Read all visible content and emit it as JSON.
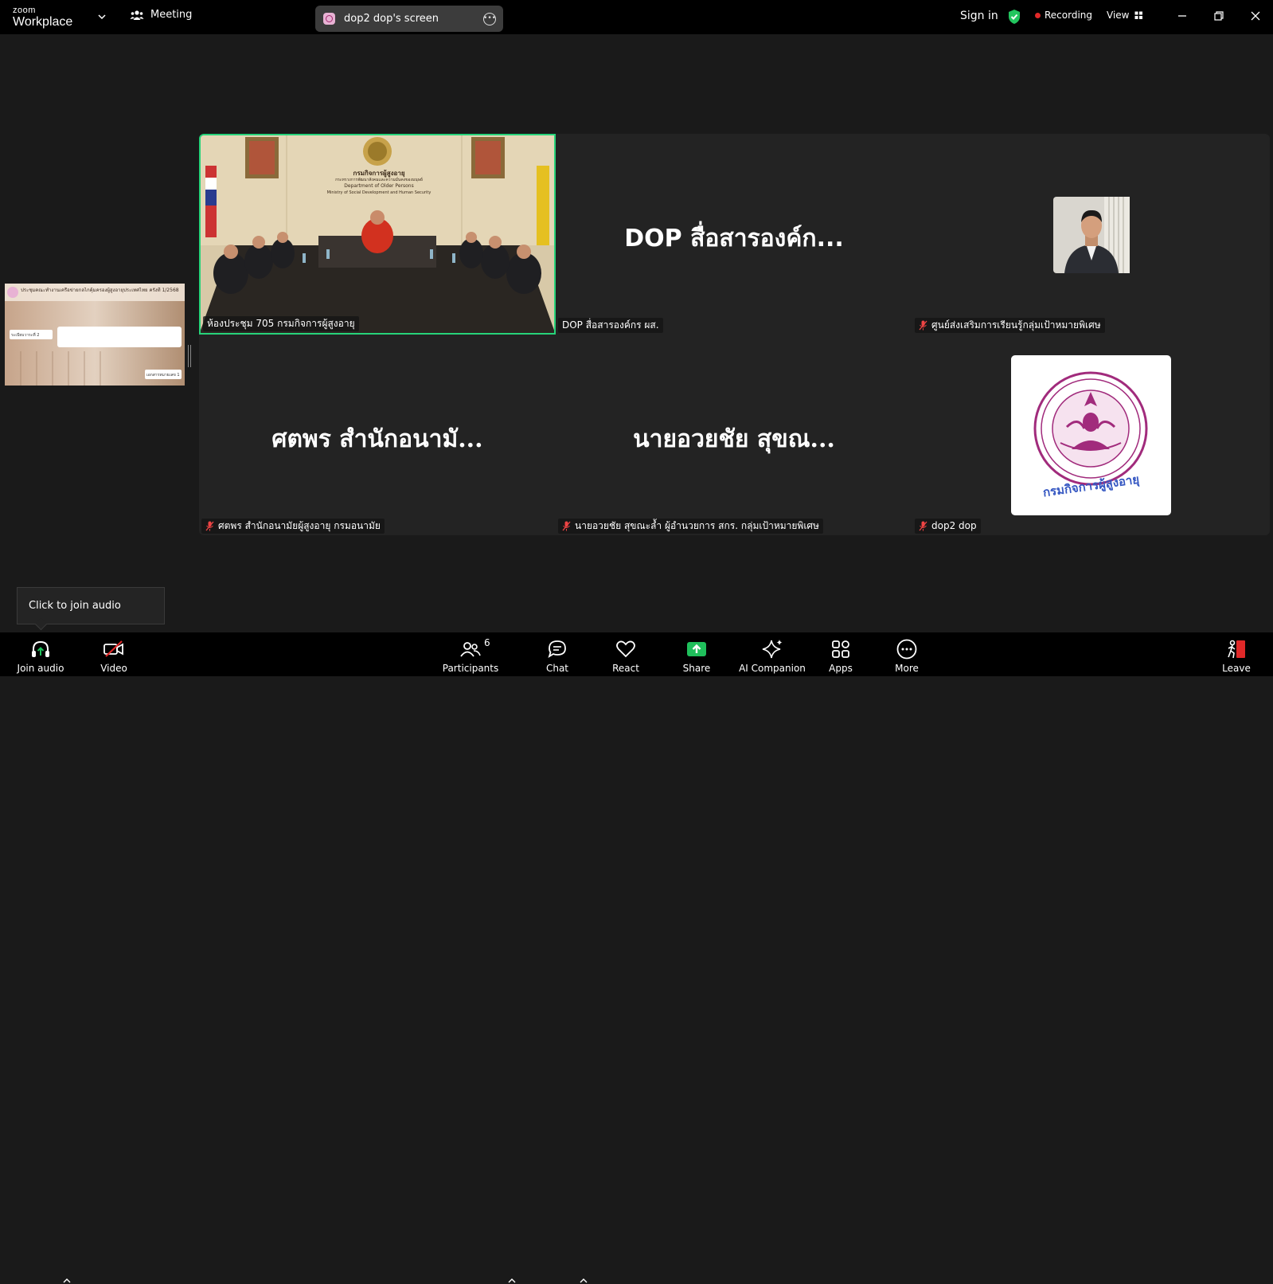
{
  "app": {
    "logo_top": "zoom",
    "logo_bottom": "Workplace"
  },
  "topbar": {
    "meeting_label": "Meeting",
    "share_pill": "dop2 dop's screen",
    "signin": "Sign in",
    "recording": "Recording",
    "view": "View"
  },
  "tiles": [
    {
      "label": "ห้องประชุม 705 กรมกิจการผู้สูงอายุ",
      "type": "video",
      "muted": false,
      "active": true
    },
    {
      "name": "DOP สื่อสารองค์ก...",
      "label": "DOP สื่อสารองค์กร ผส.",
      "type": "name",
      "muted": false
    },
    {
      "label": "ศูนย์ส่งเสริมการเรียนรู้กลุ่มเป้าหมายพิเศษ",
      "type": "photo",
      "muted": true
    },
    {
      "name": "ศตพร สำนักอนามั...",
      "label": "ศตพร สำนักอนามัยผู้สูงอายุ กรมอนามัย",
      "type": "name",
      "muted": true
    },
    {
      "name": "นายอวยชัย  สุขณ...",
      "label": "นายอวยชัย  สุขณะล้ำ ผู้อำนวยการ สกร. กลุ่มเป้าหมายพิเศษ",
      "type": "name",
      "muted": true
    },
    {
      "label": "dop2 dop",
      "type": "logo",
      "muted": true
    }
  ],
  "video_scene": {
    "sign_l1": "กรมกิจการผู้สูงอายุ",
    "sign_l2": "กระทรวงการพัฒนาสังคมและความมั่นคงของมนุษย์",
    "sign_l3": "Department of Older Persons",
    "sign_l4": "Ministry of Social Development and Human Security"
  },
  "shared_thumb": {
    "title": "ประชุมคณะทำงานเครือข่ายกลไกคุ้มครองผู้สูงอายุประเทศไทย ครั้งที่ 1/2568",
    "item": "ระเบียบวาระที่ 2",
    "badge": "เอกสารหมายเลข 1"
  },
  "logo_tile": {
    "caption": "กรมกิจการผู้สูงอายุ"
  },
  "tooltip": "Click to join audio",
  "toolbar": {
    "join_audio": "Join audio",
    "video": "Video",
    "participants": "Participants",
    "participants_count": "6",
    "chat": "Chat",
    "react": "React",
    "share": "Share",
    "ai_companion": "AI Companion",
    "apps": "Apps",
    "more": "More",
    "leave": "Leave"
  },
  "colors": {
    "active_speaker": "#27d37a",
    "share_green": "#1fbf5b",
    "leave_red": "#e02828",
    "recording_red": "#e02828",
    "verified_green": "#22c55e"
  }
}
